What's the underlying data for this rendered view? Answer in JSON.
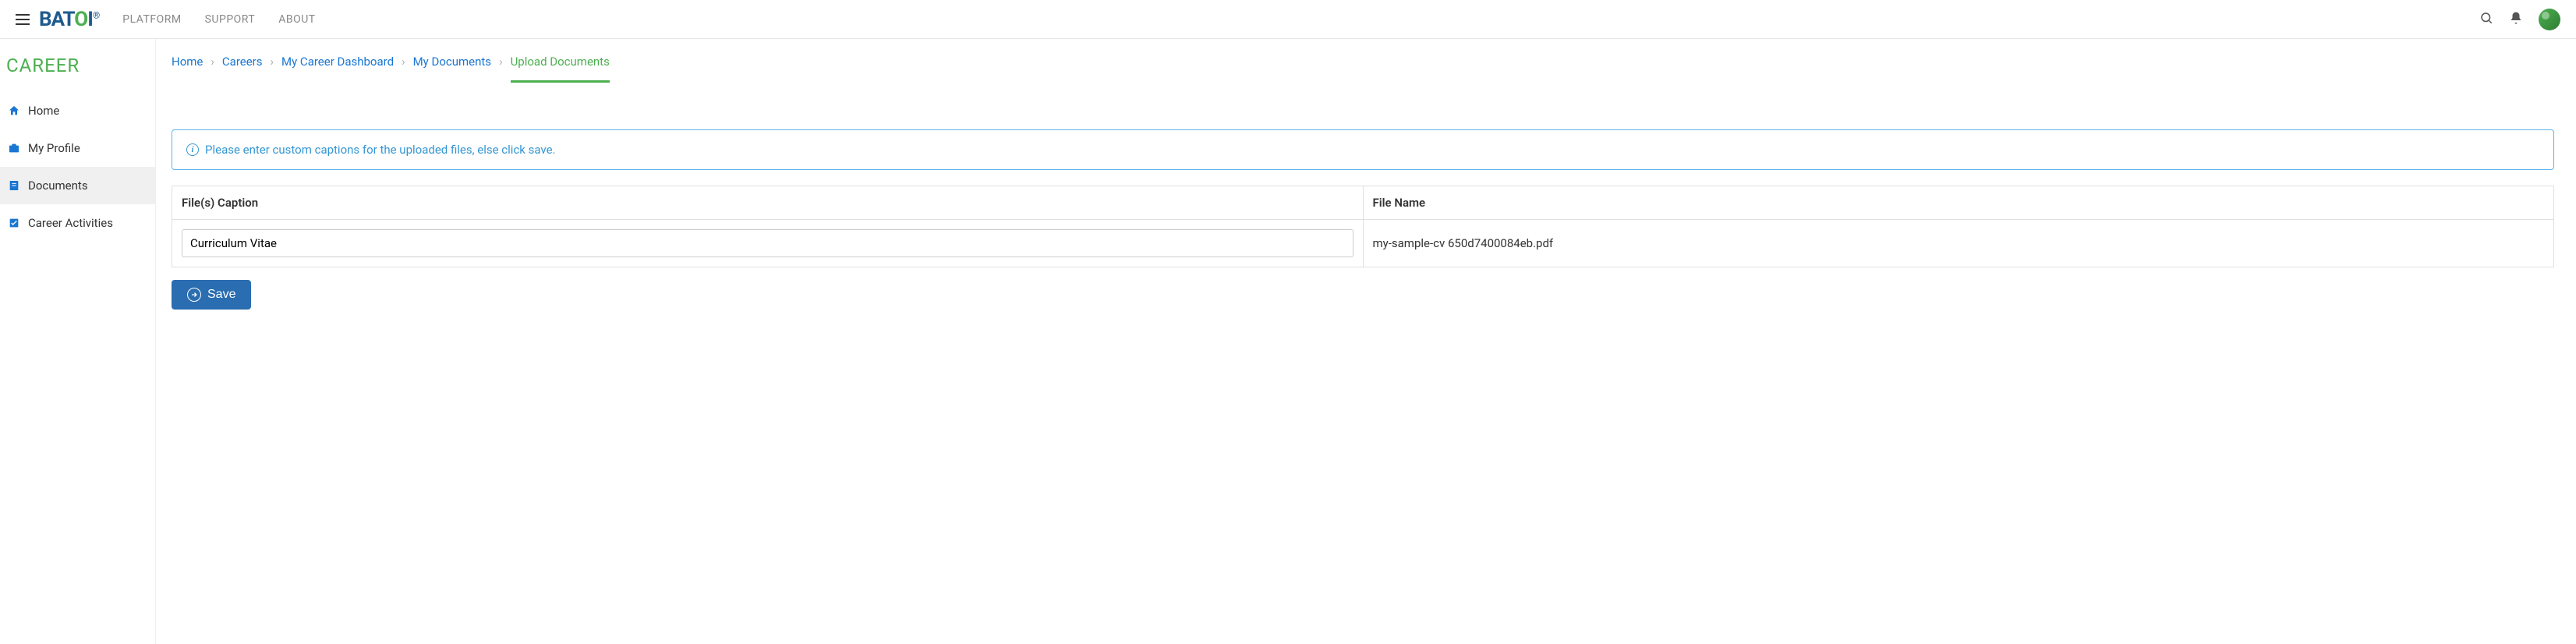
{
  "header": {
    "logo": {
      "text": "BATOI"
    },
    "nav": [
      {
        "label": "PLATFORM"
      },
      {
        "label": "SUPPORT"
      },
      {
        "label": "ABOUT"
      }
    ]
  },
  "sidebar": {
    "title": "CAREER",
    "items": [
      {
        "label": "Home",
        "icon": "home-icon"
      },
      {
        "label": "My Profile",
        "icon": "profile-icon"
      },
      {
        "label": "Documents",
        "icon": "documents-icon"
      },
      {
        "label": "Career Activities",
        "icon": "activities-icon"
      }
    ]
  },
  "breadcrumb": [
    {
      "label": "Home"
    },
    {
      "label": "Careers"
    },
    {
      "label": "My Career Dashboard"
    },
    {
      "label": "My Documents"
    },
    {
      "label": "Upload Documents",
      "current": true
    }
  ],
  "info": {
    "message": "Please enter custom captions for the uploaded files, else click save."
  },
  "table": {
    "headers": {
      "caption": "File(s) Caption",
      "filename": "File Name"
    },
    "rows": [
      {
        "caption": "Curriculum Vitae",
        "filename": "my-sample-cv 650d7400084eb.pdf"
      }
    ]
  },
  "buttons": {
    "save": "Save"
  }
}
